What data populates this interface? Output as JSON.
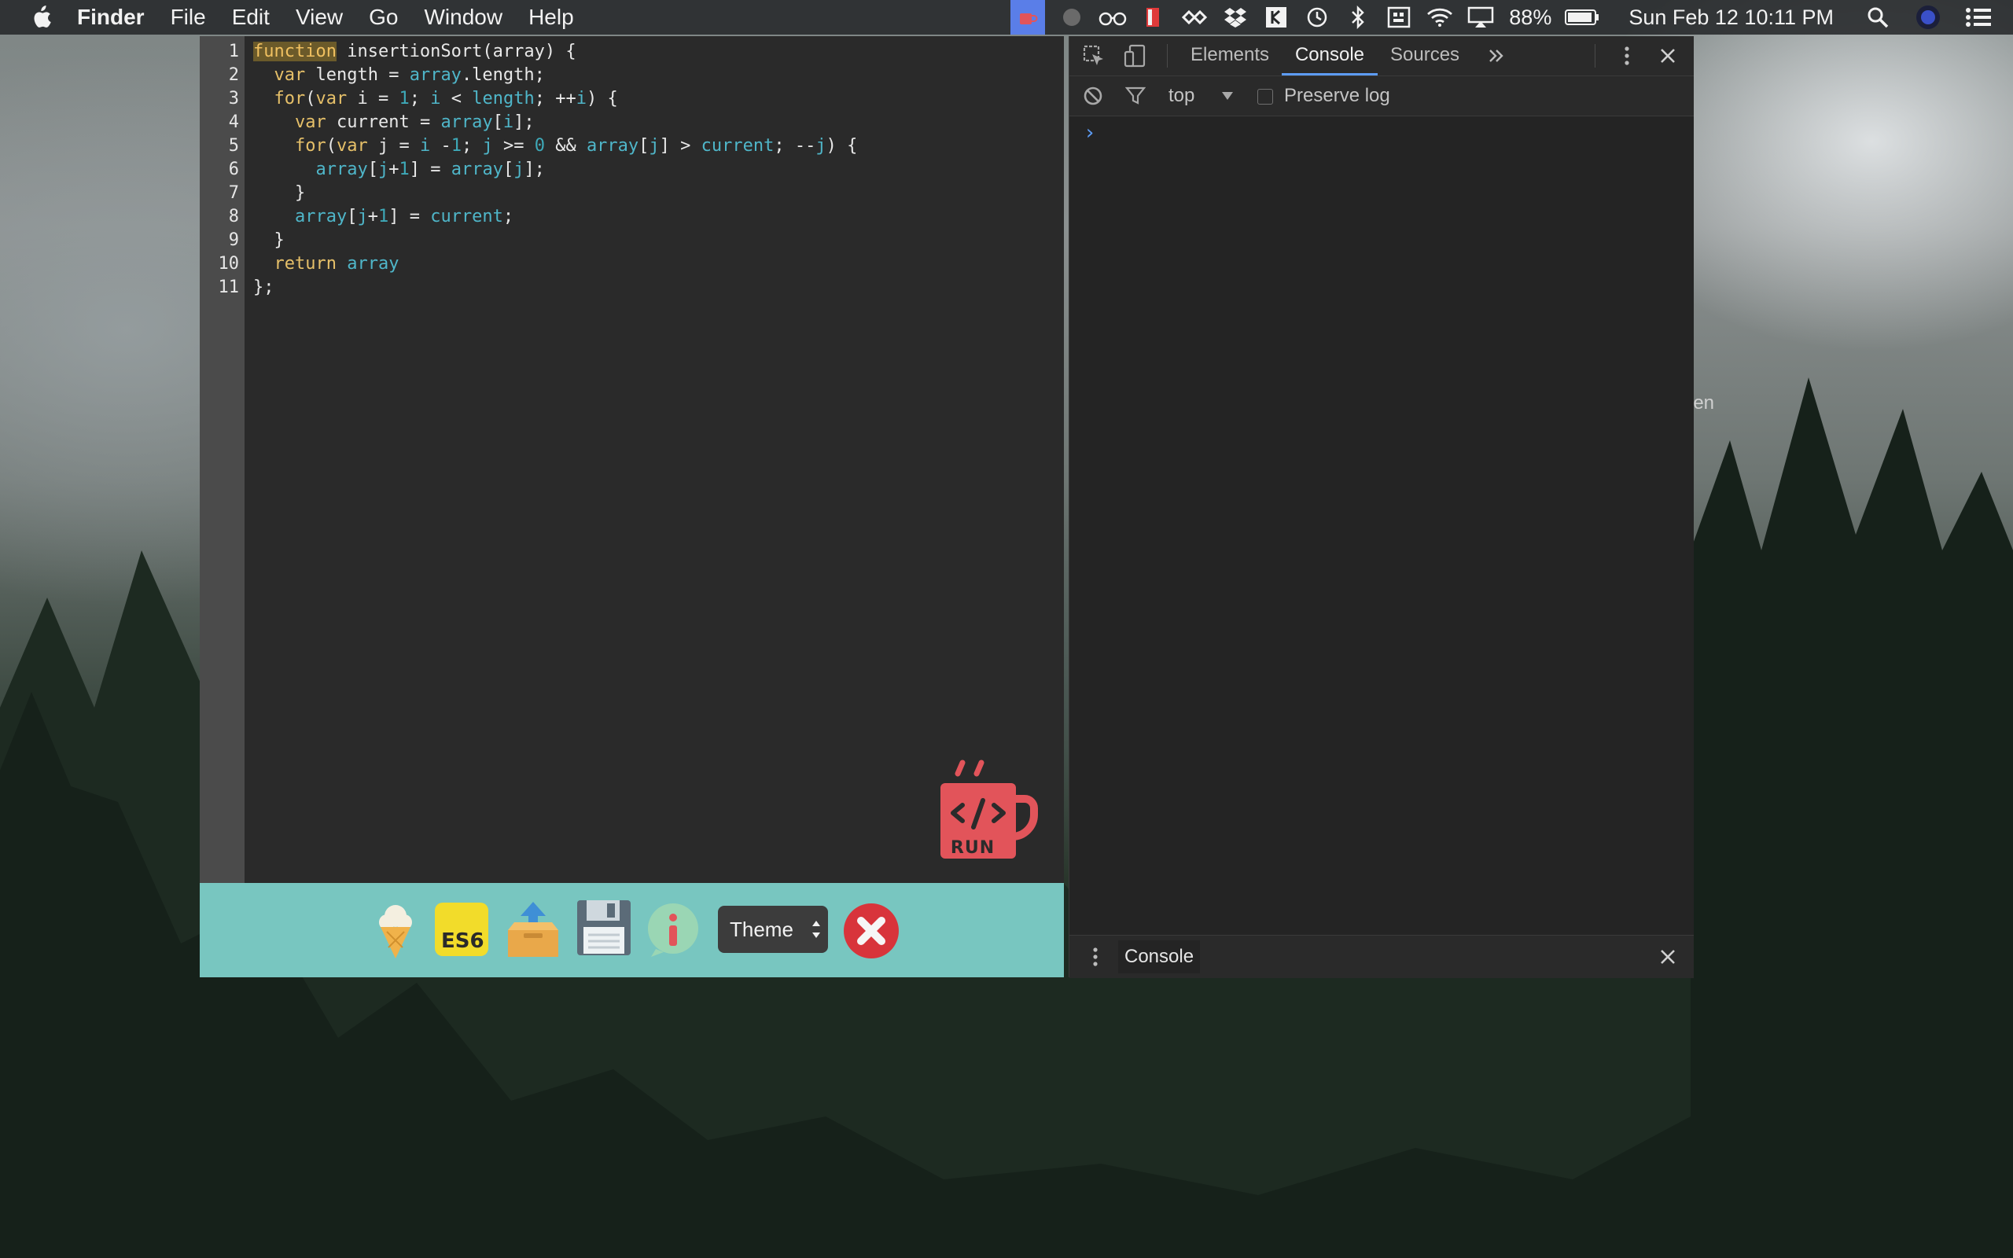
{
  "menubar": {
    "app": "Finder",
    "items": [
      "File",
      "Edit",
      "View",
      "Go",
      "Window",
      "Help"
    ],
    "battery": "88%",
    "datetime": "Sun Feb 12  10:11 PM"
  },
  "editor": {
    "line_numbers": [
      "1",
      "2",
      "3",
      "4",
      "5",
      "6",
      "7",
      "8",
      "9",
      "10",
      "11"
    ],
    "run_label": "RUN",
    "es6_label": "ES6",
    "theme_label": "Theme"
  },
  "devtools": {
    "tabs": [
      "Elements",
      "Console",
      "Sources"
    ],
    "active_tab": "Console",
    "context": "top",
    "preserve_log": "Preserve log",
    "prompt": "›",
    "drawer_tab": "Console"
  },
  "desktop": {
    "partial_label": "len"
  },
  "colors": {
    "keyword": "#e6c069",
    "identifier": "#4fb6c9",
    "toolbar": "#78c6c0",
    "run": "#e2545a",
    "devtools_accent": "#5d9cf5"
  }
}
